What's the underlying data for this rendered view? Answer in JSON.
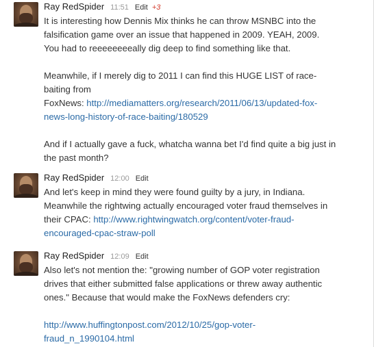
{
  "comments": [
    {
      "author": "Ray RedSpider",
      "time": "11:51",
      "edit": "Edit",
      "votes": "+3",
      "lines": [
        "It is interesting how Dennis Mix thinks he can throw MSNBC into the",
        "falsification game over an issue that happened in 2009. YEAH, 2009.",
        "You had to reeeeeeeeally dig deep to find something like that.",
        "",
        "Meanwhile, if I merely dig to 2011 I can find this HUGE LIST of race-",
        "baiting from",
        "FoxNews: ",
        "news-long-history-of-race-baiting/180529",
        "",
        "And if I actually gave a fuck, whatcha wanna bet I'd find quite a big just in",
        "the past month?"
      ],
      "link_part1": "http://mediamatters.org/research/2011/06/13/updated-fox-"
    },
    {
      "author": "Ray RedSpider",
      "time": "12:00",
      "edit": "Edit",
      "lines": [
        "And let's keep in mind they were found guilty by a jury, in Indiana.",
        "Meanwhile the rightwing actually encouraged voter fraud themselves in",
        "their CPAC: "
      ],
      "link_part1": "http://www.rightwingwatch.org/content/voter-fraud-",
      "link_part2": "encouraged-cpac-straw-poll"
    },
    {
      "author": "Ray RedSpider",
      "time": "12:09",
      "edit": "Edit",
      "lines": [
        "Also let's not mention the: \"growing number of GOP voter registration",
        "drives that either submitted false applications or threw away authentic",
        "ones.\" Because that would make the FoxNews defenders cry:"
      ],
      "link_part1": "http://www.huffingtonpost.com/2012/10/25/gop-voter-",
      "link_part2": "fraud_n_1990104.html"
    }
  ]
}
